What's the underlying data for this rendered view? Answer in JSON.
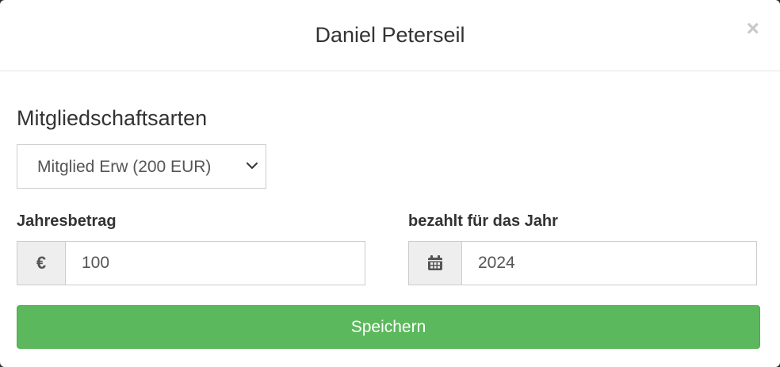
{
  "modal": {
    "title": "Daniel Peterseil",
    "close_label": "×"
  },
  "membership": {
    "heading": "Mitgliedschaftsarten",
    "selected_option": "Mitglied Erw (200 EUR)"
  },
  "annual_amount": {
    "label": "Jahresbetrag",
    "currency_symbol": "€",
    "value": "100"
  },
  "paid_year": {
    "label": "bezahlt für das Jahr",
    "icon": "calendar-icon",
    "value": "2024"
  },
  "actions": {
    "save_label": "Speichern"
  },
  "colors": {
    "success": "#5cb85c",
    "addon_bg": "#eeeeee",
    "text": "#333333"
  }
}
